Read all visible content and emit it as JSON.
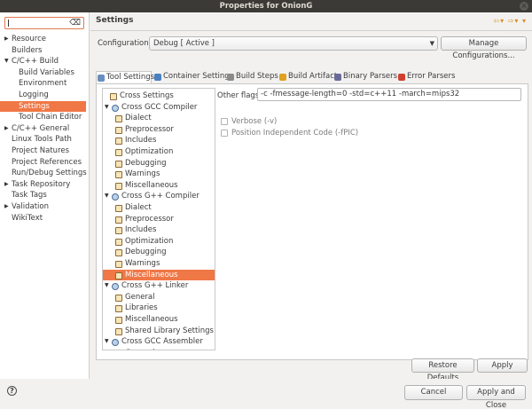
{
  "window": {
    "title": "Properties for OnionG"
  },
  "left_nav": {
    "filter_placeholder": "",
    "items": [
      {
        "label": "Resource",
        "expander": "▶"
      },
      {
        "label": "Builders",
        "expander": ""
      },
      {
        "label": "C/C++ Build",
        "expander": "▼"
      },
      {
        "label": "Build Variables",
        "expander": ""
      },
      {
        "label": "Environment",
        "expander": ""
      },
      {
        "label": "Logging",
        "expander": ""
      },
      {
        "label": "Settings",
        "expander": "",
        "selected": true
      },
      {
        "label": "Tool Chain Editor",
        "expander": ""
      },
      {
        "label": "C/C++ General",
        "expander": "▶"
      },
      {
        "label": "Linux Tools Path",
        "expander": ""
      },
      {
        "label": "Project Natures",
        "expander": ""
      },
      {
        "label": "Project References",
        "expander": ""
      },
      {
        "label": "Run/Debug Settings",
        "expander": ""
      },
      {
        "label": "Task Repository",
        "expander": "▶"
      },
      {
        "label": "Task Tags",
        "expander": ""
      },
      {
        "label": "Validation",
        "expander": "▶"
      },
      {
        "label": "WikiText",
        "expander": ""
      }
    ]
  },
  "page": {
    "title": "Settings",
    "configuration_label": "Configuration:",
    "configuration_value": "Debug  [ Active ]",
    "manage_button": "Manage Configurations..."
  },
  "tabs": [
    {
      "label": "Tool Settings",
      "active": true,
      "icon": "tool-settings-icon",
      "color": "#6a8fbf"
    },
    {
      "label": "Container Settings",
      "icon": "container-icon",
      "color": "#4a7fc0"
    },
    {
      "label": "Build Steps",
      "icon": "build-steps-icon",
      "color": "#8a8a8a"
    },
    {
      "label": "Build Artifact",
      "icon": "build-artifact-icon",
      "color": "#e0a020"
    },
    {
      "label": "Binary Parsers",
      "icon": "binary-parsers-icon",
      "color": "#6a6a9a"
    },
    {
      "label": "Error Parsers",
      "icon": "error-parsers-icon",
      "color": "#d04030"
    }
  ],
  "tool_tree": [
    {
      "label": "Cross Settings",
      "level": 0,
      "kind": "leaf"
    },
    {
      "label": "Cross GCC Compiler",
      "level": 0,
      "kind": "group",
      "expander": "▼"
    },
    {
      "label": "Dialect",
      "level": 1,
      "kind": "leaf"
    },
    {
      "label": "Preprocessor",
      "level": 1,
      "kind": "leaf"
    },
    {
      "label": "Includes",
      "level": 1,
      "kind": "leaf"
    },
    {
      "label": "Optimization",
      "level": 1,
      "kind": "leaf"
    },
    {
      "label": "Debugging",
      "level": 1,
      "kind": "leaf"
    },
    {
      "label": "Warnings",
      "level": 1,
      "kind": "leaf"
    },
    {
      "label": "Miscellaneous",
      "level": 1,
      "kind": "leaf"
    },
    {
      "label": "Cross G++ Compiler",
      "level": 0,
      "kind": "group",
      "expander": "▼"
    },
    {
      "label": "Dialect",
      "level": 1,
      "kind": "leaf"
    },
    {
      "label": "Preprocessor",
      "level": 1,
      "kind": "leaf"
    },
    {
      "label": "Includes",
      "level": 1,
      "kind": "leaf"
    },
    {
      "label": "Optimization",
      "level": 1,
      "kind": "leaf"
    },
    {
      "label": "Debugging",
      "level": 1,
      "kind": "leaf"
    },
    {
      "label": "Warnings",
      "level": 1,
      "kind": "leaf"
    },
    {
      "label": "Miscellaneous",
      "level": 1,
      "kind": "leaf",
      "selected": true
    },
    {
      "label": "Cross G++ Linker",
      "level": 0,
      "kind": "group",
      "expander": "▼"
    },
    {
      "label": "General",
      "level": 1,
      "kind": "leaf"
    },
    {
      "label": "Libraries",
      "level": 1,
      "kind": "leaf"
    },
    {
      "label": "Miscellaneous",
      "level": 1,
      "kind": "leaf"
    },
    {
      "label": "Shared Library Settings",
      "level": 1,
      "kind": "leaf"
    },
    {
      "label": "Cross GCC Assembler",
      "level": 0,
      "kind": "group",
      "expander": "▼"
    },
    {
      "label": "General",
      "level": 1,
      "kind": "leaf"
    }
  ],
  "options": {
    "other_flags_label": "Other flags",
    "other_flags_value": "-c -fmessage-length=0  -std=c++11 -march=mips32",
    "verbose_label": "Verbose (-v)",
    "verbose_checked": false,
    "pic_label": "Position Independent Code (-fPIC)",
    "pic_checked": false
  },
  "buttons": {
    "restore_defaults": "Restore Defaults",
    "apply": "Apply",
    "cancel": "Cancel",
    "apply_and_close": "Apply and Close"
  },
  "colors": {
    "selection": "#f07746",
    "title_bar": "#3b3a37"
  }
}
